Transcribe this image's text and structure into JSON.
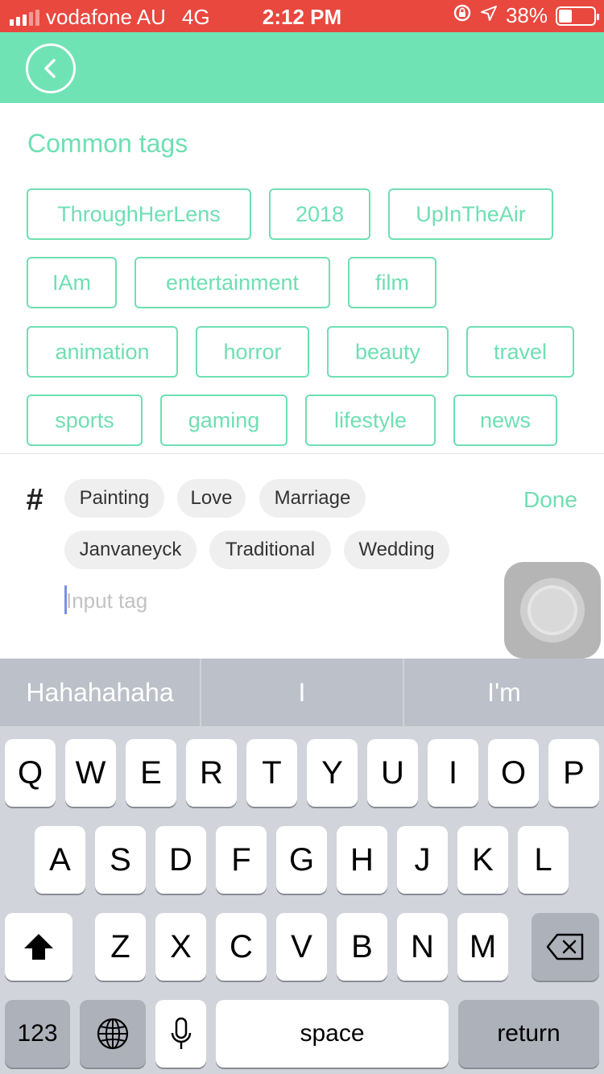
{
  "status_bar": {
    "carrier": "vodafone AU",
    "network": "4G",
    "time": "2:12 PM",
    "battery": "38%",
    "battery_level": 0.38,
    "icons": [
      "signal-icon",
      "rotation-lock-icon",
      "location-icon",
      "battery-icon"
    ]
  },
  "nav": {
    "back_icon": "chevron-left-icon"
  },
  "common_tags": {
    "title": "Common tags",
    "tags": [
      "ThroughHerLens",
      "2018",
      "UpInTheAir",
      "IAm",
      "entertainment",
      "film",
      "animation",
      "horror",
      "beauty",
      "travel",
      "sports",
      "gaming",
      "lifestyle",
      "news"
    ]
  },
  "tag_input": {
    "hash_symbol": "#",
    "selected_tags": [
      "Painting",
      "Love",
      "Marriage",
      "Janvaneyck",
      "Traditional",
      "Wedding"
    ],
    "done_label": "Done",
    "placeholder": "Input tag",
    "value": ""
  },
  "keyboard": {
    "suggestions": [
      "Hahahahaha",
      "I",
      "I'm"
    ],
    "row1": [
      "Q",
      "W",
      "E",
      "R",
      "T",
      "Y",
      "U",
      "I",
      "O",
      "P"
    ],
    "row2": [
      "A",
      "S",
      "D",
      "F",
      "G",
      "H",
      "J",
      "K",
      "L"
    ],
    "row3": [
      "Z",
      "X",
      "C",
      "V",
      "B",
      "N",
      "M"
    ],
    "numbers_label": "123",
    "space_label": "space",
    "return_label": "return",
    "icons": [
      "shift-icon",
      "backspace-icon",
      "globe-icon",
      "microphone-icon"
    ]
  },
  "colors": {
    "accent": "#70e3b4",
    "status_bar": "#e9483f",
    "tag_text": "#6fdfb3",
    "chip_bg": "#efefef",
    "keyboard_bg": "#d1d4da"
  }
}
